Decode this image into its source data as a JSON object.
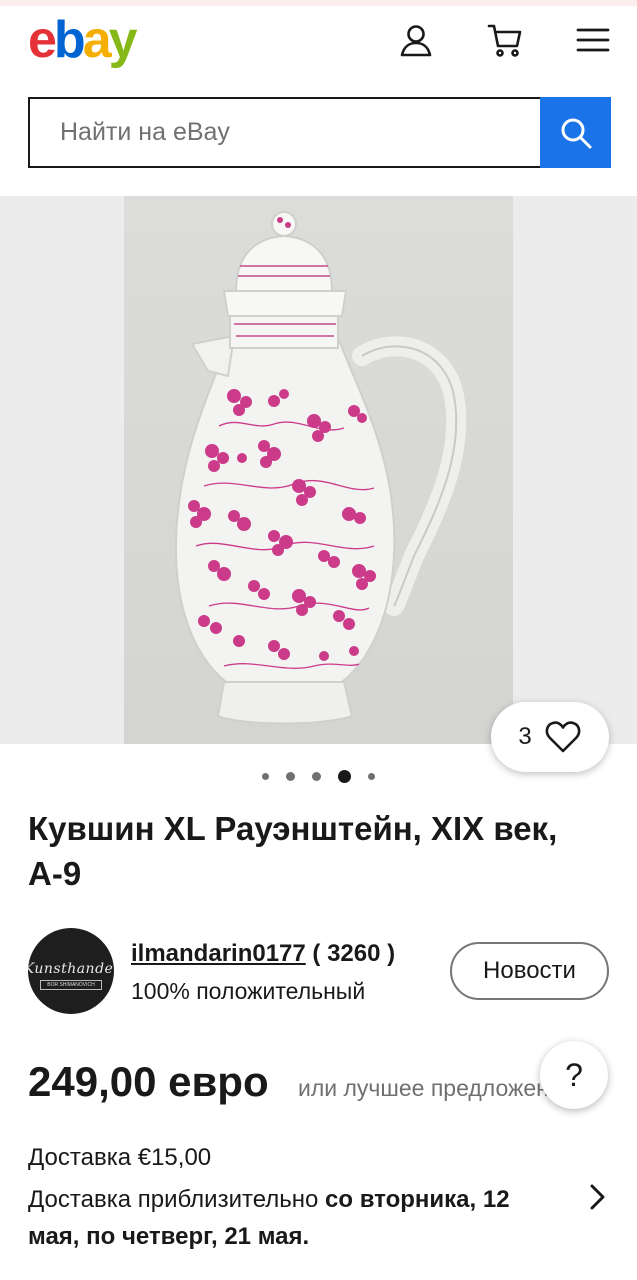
{
  "header": {
    "logo_letters": [
      "e",
      "b",
      "a",
      "y"
    ],
    "icons": [
      "account-icon",
      "cart-icon",
      "menu-icon"
    ]
  },
  "search": {
    "placeholder": "Найти на eBay",
    "button_icon": "search-icon"
  },
  "gallery": {
    "watch_count": "3",
    "watch_icon": "heart-icon",
    "dots_count": 5,
    "active_dot": 3
  },
  "listing": {
    "title": "Кувшин XL Рауэнштейн, XIX век, А-9"
  },
  "seller": {
    "name": "ilmandarin0177",
    "score": "( 3260 )",
    "feedback": "100% положительный",
    "news_button": "Новости"
  },
  "price": {
    "amount": "249,00 евро",
    "best_offer": "или лучшее предложение",
    "help_label": "?"
  },
  "shipping": {
    "cost": "Доставка €15,00",
    "estimate_prefix": "Доставка приблизительно ",
    "estimate_bold": "со вторника, 12 мая, по четверг, 21 мая."
  },
  "colors": {
    "accent_blue": "#1a74e8",
    "logo_red": "#e53238",
    "logo_blue": "#0064d2",
    "logo_yellow": "#f5af02",
    "logo_green": "#86b817"
  }
}
